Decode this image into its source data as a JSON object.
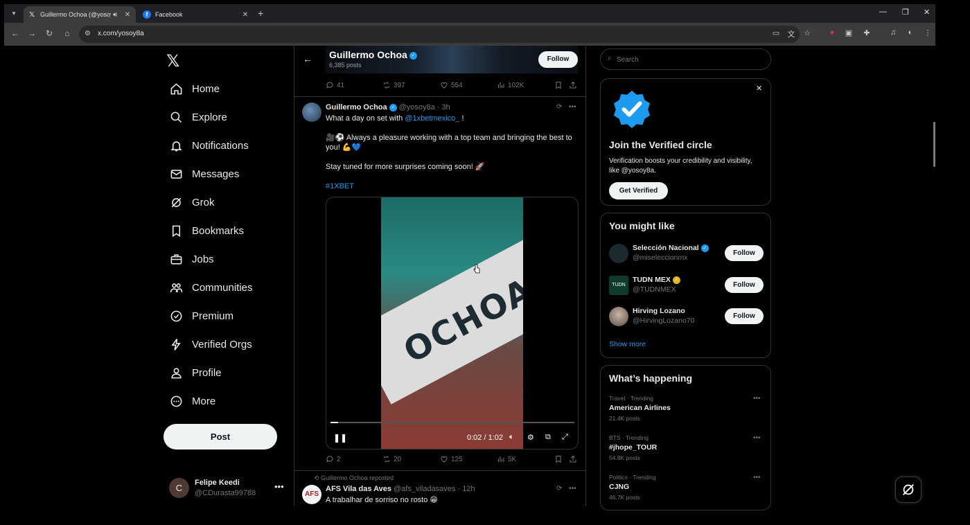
{
  "browser": {
    "tabs": [
      {
        "title": "Guillermo Ochoa (@yosoy8",
        "favicon": "x-icon",
        "active": true
      },
      {
        "title": "Facebook",
        "favicon": "facebook-icon",
        "active": false
      }
    ],
    "url": "x.com/yosoy8a"
  },
  "nav": {
    "items": [
      {
        "label": "Home",
        "icon": "home-icon"
      },
      {
        "label": "Explore",
        "icon": "search-icon"
      },
      {
        "label": "Notifications",
        "icon": "bell-icon"
      },
      {
        "label": "Messages",
        "icon": "mail-icon"
      },
      {
        "label": "Grok",
        "icon": "grok-icon"
      },
      {
        "label": "Bookmarks",
        "icon": "bookmark-icon"
      },
      {
        "label": "Jobs",
        "icon": "briefcase-icon"
      },
      {
        "label": "Communities",
        "icon": "people-icon"
      },
      {
        "label": "Premium",
        "icon": "premium-icon"
      },
      {
        "label": "Verified Orgs",
        "icon": "lightning-icon"
      },
      {
        "label": "Profile",
        "icon": "person-icon"
      },
      {
        "label": "More",
        "icon": "more-circle-icon"
      }
    ],
    "post_label": "Post",
    "account": {
      "initial": "C",
      "name": "Felipe Keedi",
      "handle": "@CDurasta99788"
    }
  },
  "profile_header": {
    "name": "Guillermo Ochoa",
    "posts": "6,385 posts",
    "follow_label": "Follow"
  },
  "prev_tweet_stats": {
    "replies": "41",
    "reposts": "397",
    "likes": "554",
    "views": "102K"
  },
  "tweet": {
    "name": "Guillermo Ochoa",
    "handle_time": "@yosoy8a · 3h",
    "line1_prefix": "What a day on set with ",
    "line1_mention": "@1xbetmexico_",
    "line1_suffix": " !",
    "line2": "🎥⚽ Always a pleasure working with a top team and bringing the best to you! 💪💙",
    "line3": "Stay tuned for more surprises coming soon! 🚀",
    "hashtag": "#1XBET",
    "video": {
      "brand_text": "OCHOA",
      "time": "0:02 / 1:02",
      "progress": 0.03
    },
    "stats": {
      "replies": "2",
      "reposts": "20",
      "likes": "125",
      "views": "5K"
    }
  },
  "tweet2": {
    "repost_line": "Guillermo Ochoa reposted",
    "name": "AFS Vila das Aves",
    "handle_time": "@afs_viladasaves · 12h",
    "text": "A trabalhar de sorriso no rosto 😁",
    "avatar_text": "AFS"
  },
  "search": {
    "placeholder": "Search"
  },
  "verified_card": {
    "title": "Join the Verified circle",
    "text": "Verification boosts your credibility and visibility, like @yosoy8a.",
    "button": "Get Verified"
  },
  "you_might_like": {
    "title": "You might like",
    "people": [
      {
        "name": "Selección Nacional",
        "handle": "@miseleccionmx",
        "badge": "blue",
        "follow": "Follow"
      },
      {
        "name": "TUDN MEX",
        "handle": "@TUDNMEX",
        "badge": "gold",
        "follow": "Follow"
      },
      {
        "name": "Hirving Lozano",
        "handle": "@HirvingLozano70",
        "badge": "none",
        "follow": "Follow"
      }
    ],
    "show_more": "Show more"
  },
  "whats_happening": {
    "title": "What’s happening",
    "trends": [
      {
        "meta": "Travel · Trending",
        "title": "American Airlines",
        "posts": "21.4K posts"
      },
      {
        "meta": "BTS · Trending",
        "title": "#jhope_TOUR",
        "posts": "54.8K posts"
      },
      {
        "meta": "Politics · Trending",
        "title": "CJNG",
        "posts": "46.7K posts"
      }
    ]
  },
  "colors": {
    "accent": "#1d9bf0",
    "background": "#000000",
    "gold_badge": "#e2b719"
  }
}
